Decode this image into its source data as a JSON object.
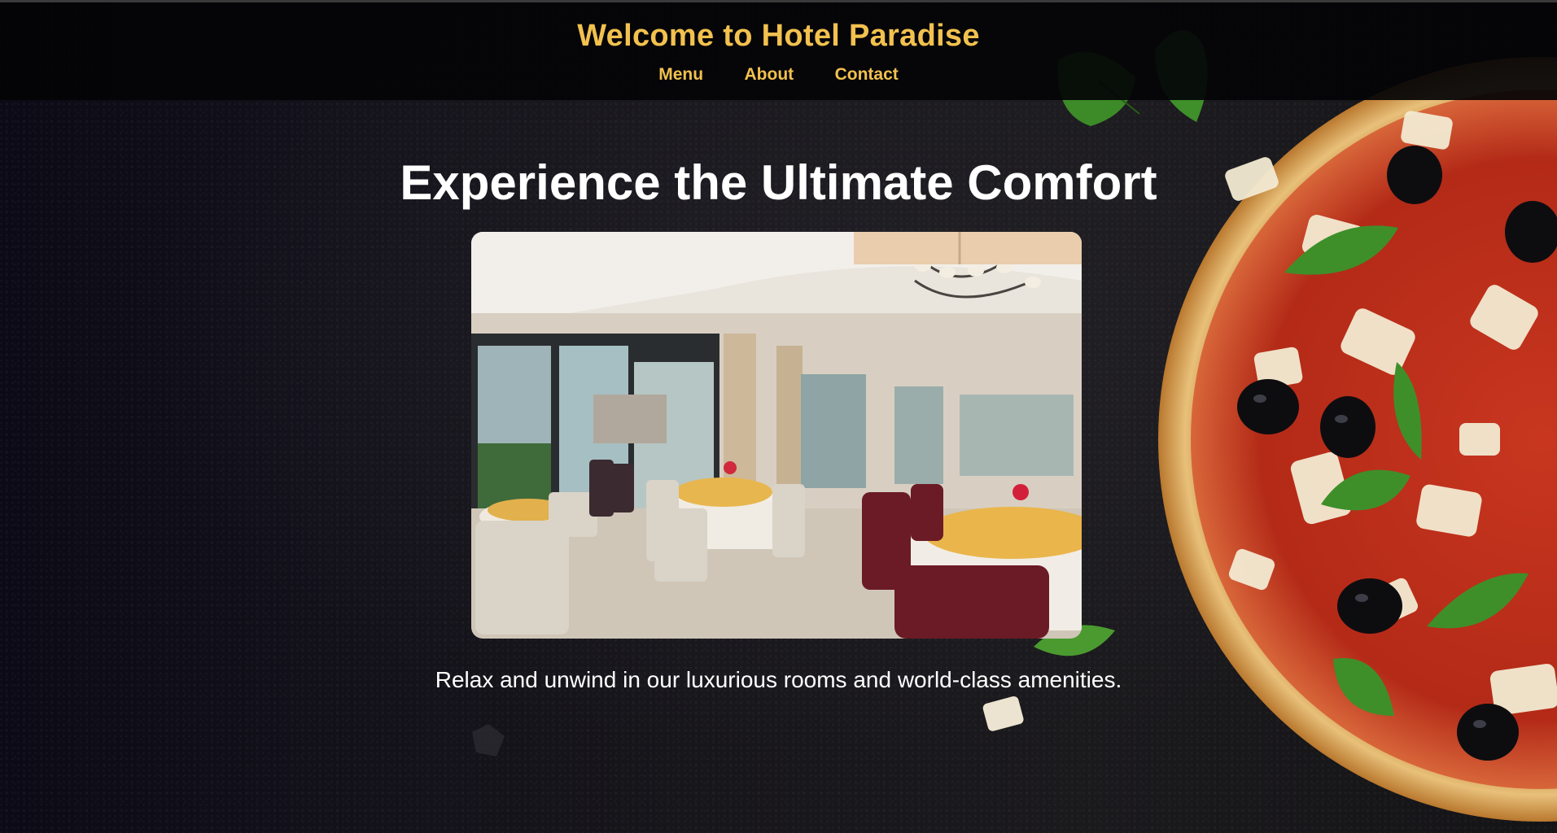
{
  "header": {
    "title": "Welcome to Hotel Paradise",
    "nav": [
      {
        "label": "Menu"
      },
      {
        "label": "About"
      },
      {
        "label": "Contact"
      }
    ]
  },
  "hero": {
    "title": "Experience the Ultimate Comfort",
    "image_alt": "Hotel restaurant dining room",
    "tagline": "Relax and unwind in our luxurious rooms and world-class amenities."
  },
  "colors": {
    "accent": "#f2c14e",
    "header_bg": "#050507",
    "page_bg": "#121018",
    "text": "#ffffff"
  },
  "decor": {
    "background_image": "pizza-with-basil-and-olives",
    "icons": [
      "basil-leaf-icon",
      "cheese-flake-icon"
    ]
  }
}
